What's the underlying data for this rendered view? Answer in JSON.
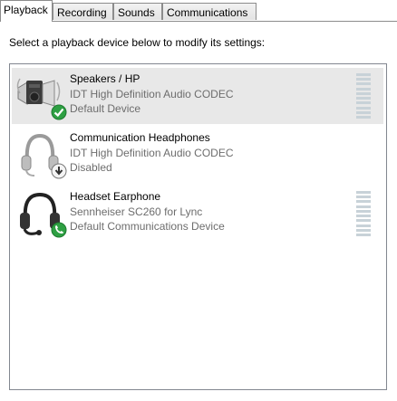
{
  "tabs": [
    {
      "label": "Playback"
    },
    {
      "label": "Recording"
    },
    {
      "label": "Sounds"
    },
    {
      "label": "Communications"
    }
  ],
  "instruction": "Select a playback device below to modify its settings:",
  "devices": [
    {
      "name": "Speakers / HP",
      "driver": "IDT High Definition Audio CODEC",
      "status": "Default Device",
      "icon": "speakers-icon",
      "badge": "green-check-badge",
      "selected": true,
      "has_meter": true
    },
    {
      "name": "Communication Headphones",
      "driver": "IDT High Definition Audio CODEC",
      "status": "Disabled",
      "icon": "headphones-icon",
      "badge": "disabled-arrow-badge",
      "selected": false,
      "has_meter": false
    },
    {
      "name": "Headset Earphone",
      "driver": "Sennheiser SC260 for Lync",
      "status": "Default Communications Device",
      "icon": "headset-icon",
      "badge": "phone-badge",
      "selected": false,
      "has_meter": true
    }
  ],
  "colors": {
    "check_green": "#2ea043",
    "selection_bg": "#e8e8e8",
    "meter": "#c8d2d8"
  }
}
